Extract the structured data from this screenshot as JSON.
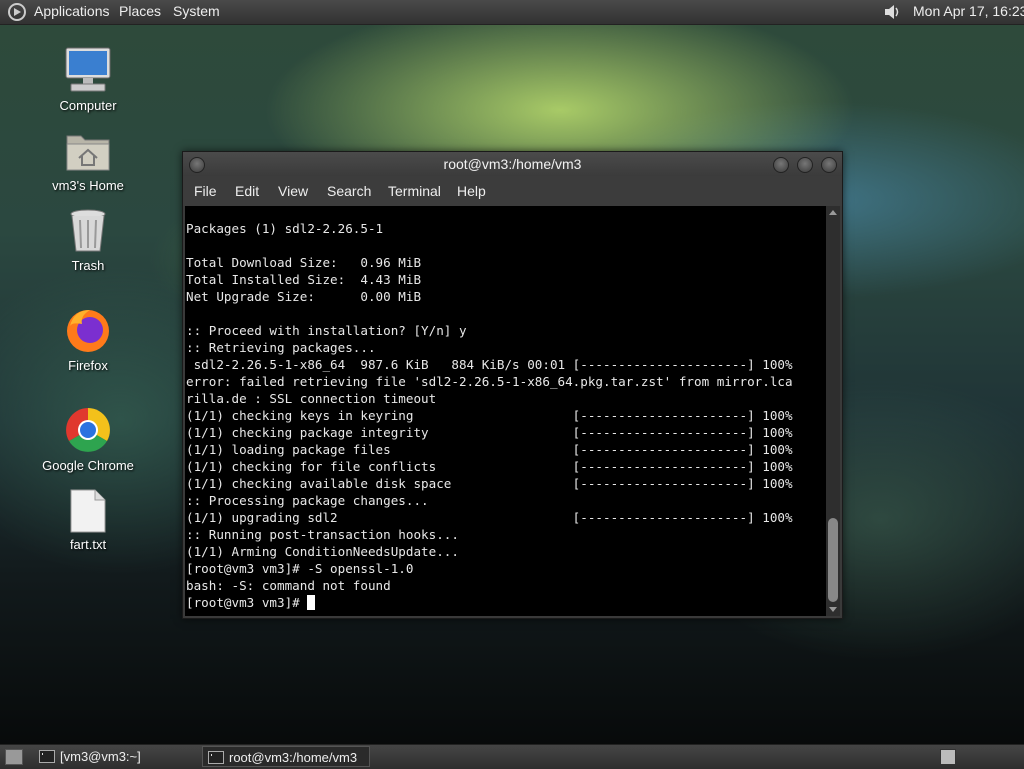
{
  "top_panel": {
    "menus": [
      "Applications",
      "Places",
      "System"
    ],
    "clock": "Mon Apr 17, 16:23"
  },
  "desktop": {
    "icons": [
      {
        "label": "Computer"
      },
      {
        "label": "vm3's Home"
      },
      {
        "label": "Trash"
      },
      {
        "label": "Firefox"
      },
      {
        "label": "Google Chrome"
      },
      {
        "label": "fart.txt"
      }
    ]
  },
  "terminal": {
    "title": "root@vm3:/home/vm3",
    "menu": [
      "File",
      "Edit",
      "View",
      "Search",
      "Terminal",
      "Help"
    ],
    "lines": [
      "Packages (1) sdl2-2.26.5-1",
      "",
      "Total Download Size:   0.96 MiB",
      "Total Installed Size:  4.43 MiB",
      "Net Upgrade Size:      0.00 MiB",
      "",
      ":: Proceed with installation? [Y/n] y",
      ":: Retrieving packages...",
      " sdl2-2.26.5-1-x86_64  987.6 KiB   884 KiB/s 00:01 [----------------------] 100%",
      "error: failed retrieving file 'sdl2-2.26.5-1-x86_64.pkg.tar.zst' from mirror.lca",
      "rilla.de : SSL connection timeout",
      "(1/1) checking keys in keyring                     [----------------------] 100%",
      "(1/1) checking package integrity                   [----------------------] 100%",
      "(1/1) loading package files                        [----------------------] 100%",
      "(1/1) checking for file conflicts                  [----------------------] 100%",
      "(1/1) checking available disk space                [----------------------] 100%",
      ":: Processing package changes...",
      "(1/1) upgrading sdl2                               [----------------------] 100%",
      ":: Running post-transaction hooks...",
      "(1/1) Arming ConditionNeedsUpdate...",
      "[root@vm3 vm3]# -S openssl-1.0",
      "bash: -S: command not found"
    ],
    "prompt": "[root@vm3 vm3]# "
  },
  "taskbar": {
    "tasks": [
      {
        "label": "[vm3@vm3:~]"
      },
      {
        "label": "root@vm3:/home/vm3"
      }
    ]
  }
}
